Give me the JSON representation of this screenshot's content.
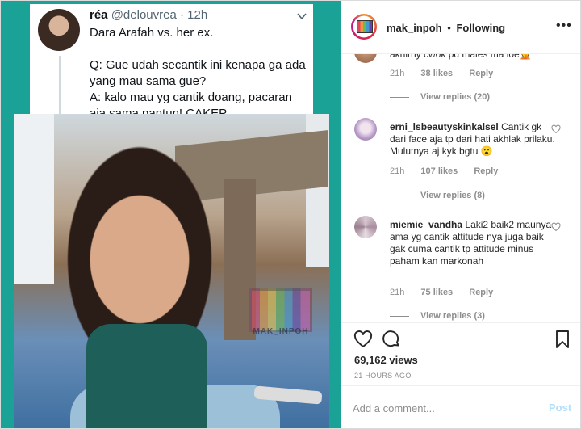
{
  "tweet": {
    "name": "réa",
    "handle": "@delouvrea",
    "sep": "·",
    "time": "12h",
    "line1": "Dara Arafah vs. her ex.",
    "line2": "Q: Gue udah secantik ini kenapa ga ada yang mau sama gue?",
    "line3": "A: kalo mau yg cantik doang, pacaran aja sama pantun! CAKEP"
  },
  "video": {
    "watermark": "MAK_INPOH"
  },
  "header": {
    "username": "mak_inpoh",
    "dot": "•",
    "following": "Following",
    "more": "•••"
  },
  "comments": [
    {
      "partial_text": "akhirny cwok pd males ma loe🤦",
      "time": "21h",
      "likes": "38 likes",
      "reply": "Reply",
      "view_replies": "View replies (20)"
    },
    {
      "username": "erni_lsbeautyskinkalsel",
      "text": "Cantik gk dari face aja tp dari hati akhlak prilaku. Mulutnya aj kyk bgtu 😮",
      "time": "21h",
      "likes": "107 likes",
      "reply": "Reply",
      "view_replies": "View replies (8)"
    },
    {
      "username": "miemie_vandha",
      "text": "Laki2 baik2 maunya ama yg cantik attitude nya juga baik gak cuma cantik tp attitude minus paham kan markonah",
      "time": "21h",
      "likes": "75 likes",
      "reply": "Reply",
      "view_replies": "View replies (3)"
    }
  ],
  "stats": {
    "views": "69,162 views",
    "time_ago": "21 HOURS AGO"
  },
  "composer": {
    "placeholder": "Add a comment...",
    "post": "Post"
  }
}
